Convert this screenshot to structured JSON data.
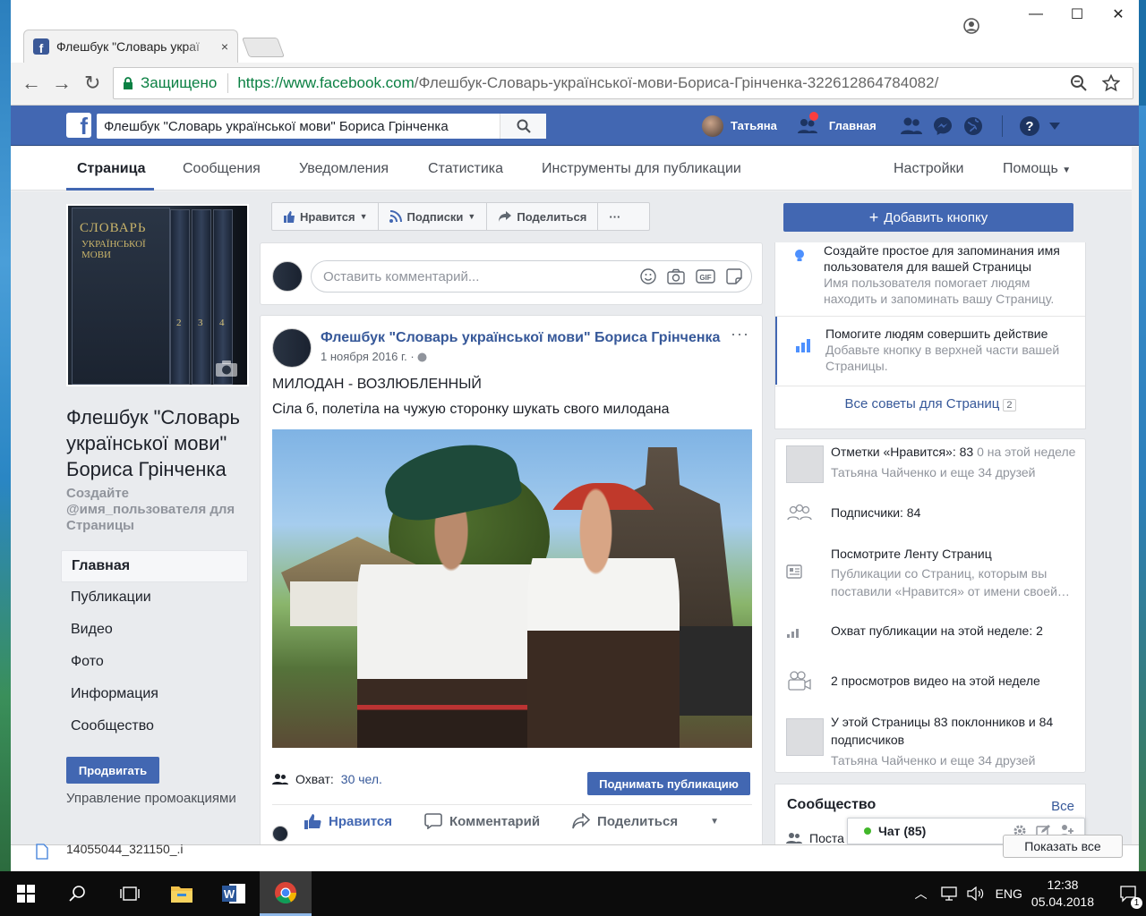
{
  "browser": {
    "tab_title": "Флешбук \"Словарь украї",
    "tab_close": "×",
    "security_label": "Защищено",
    "url_host": "https://www.facebook.com",
    "url_path": "/Флешбук-Словарь-української-мови-Бориса-Грінченка-322612864784082/"
  },
  "fb_header": {
    "search_value": "Флешбук \"Словарь української мови\" Бориса Грінченка",
    "user_name": "Татьяна",
    "home_label": "Главная"
  },
  "page_nav": {
    "items": [
      "Страница",
      "Сообщения",
      "Уведомления",
      "Статистика",
      "Инструменты для публикации"
    ],
    "settings": "Настройки",
    "help": "Помощь"
  },
  "left": {
    "cover_title": "СЛОВАРЬ",
    "cover_subtitle": "УКРАЇНСЬКОЇ МОВИ",
    "volumes": [
      "1",
      "2",
      "3",
      "4"
    ],
    "page_title": "Флешбук \"Словарь української мови\" Бориса Грінченка",
    "handle_prompt": "Создайте @имя_пользователя для Страницы",
    "menu": [
      "Главная",
      "Публикации",
      "Видео",
      "Фото",
      "Информация",
      "Сообщество"
    ],
    "promote_button": "Продвигать",
    "promo_link": "Управление промоакциями"
  },
  "action_bar": {
    "like": "Нравится",
    "follow": "Подписки",
    "share": "Поделиться",
    "more": "···"
  },
  "composer": {
    "placeholder": "Оставить комментарий..."
  },
  "post": {
    "author": "Флешбук \"Словарь української мови\" Бориса Грінченка",
    "date": "1 ноября 2016 г. ·",
    "more": "···",
    "line1": "МИЛОДАН - ВОЗЛЮБЛЕННЫЙ",
    "line2": "Сіла б, полетіла на чужую сторонку шукать свого милодана",
    "reach_label": "Охват:",
    "reach_value": "30 чел.",
    "boost_button": "Поднимать публикацию",
    "like": "Нравится",
    "comment": "Комментарий",
    "share": "Поделиться"
  },
  "right": {
    "add_button": "Добавить кнопку",
    "tip1_title": "Создайте простое для запоминания имя пользователя для вашей Страницы",
    "tip1_sub": "Имя пользователя помогает людям находить и запоминать вашу Страницу.",
    "tip2_title": "Помогите людям совершить действие",
    "tip2_sub": "Добавьте кнопку в верхней части вашей Страницы.",
    "all_tips": "Все советы для Страниц",
    "all_tips_count": "2",
    "likes_line": "Отметки «Нравится»: 83",
    "likes_week": "0 на этой неделе",
    "likes_friends_name": "Татьяна Чайченко",
    "likes_friends_rest": "и еще 34 друзей",
    "followers": "Подписчики: 84",
    "feed_title": "Посмотрите Ленту Страниц",
    "feed_sub": "Публикации со Страниц, которым вы поставили «Нравится» от имени своей…",
    "reach_week": "Охват публикации на этой неделе: 2",
    "video_views": "2 просмотров видео на этой неделе",
    "fans": "У этой Страницы 83 поклонников и 84 подписчиков",
    "fans_friends_name": "Татьяна Чайченко",
    "fans_friends_rest": "и еще 34 друзей",
    "community_title": "Сообщество",
    "community_all": "Все",
    "community_partial": "Поста"
  },
  "chat": {
    "label": "Чат (85)"
  },
  "downloads": {
    "file": "14055044_321150_.i",
    "show_all": "Показать все"
  },
  "taskbar": {
    "lang": "ENG",
    "time": "12:38",
    "date": "05.04.2018",
    "notif_count": "1"
  },
  "colors": {
    "fb_blue": "#4267b2",
    "link": "#365899",
    "secure_green": "#0b8043"
  }
}
